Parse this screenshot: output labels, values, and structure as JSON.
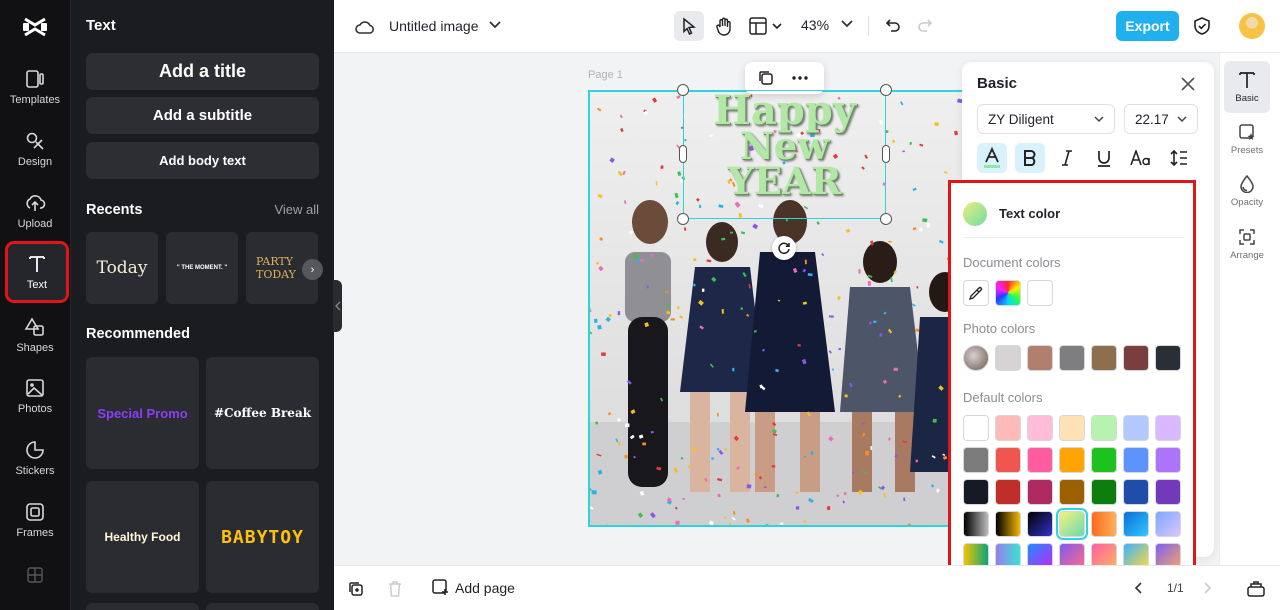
{
  "rail": {
    "items": [
      {
        "label": "Templates",
        "icon": "templates-icon"
      },
      {
        "label": "Design",
        "icon": "design-icon"
      },
      {
        "label": "Upload",
        "icon": "upload-icon"
      },
      {
        "label": "Text",
        "icon": "text-icon",
        "active": true
      },
      {
        "label": "Shapes",
        "icon": "shapes-icon"
      },
      {
        "label": "Photos",
        "icon": "photos-icon"
      },
      {
        "label": "Stickers",
        "icon": "stickers-icon"
      },
      {
        "label": "Frames",
        "icon": "frames-icon"
      }
    ]
  },
  "panel": {
    "title": "Text",
    "add_title": "Add a title",
    "add_subtitle": "Add a subtitle",
    "add_body": "Add body text",
    "recents_title": "Recents",
    "view_all": "View all",
    "recents": [
      "Today",
      "\" THE MOMENT. \"",
      "PARTY TODAY"
    ],
    "recommended_title": "Recommended",
    "recommended": [
      "Special Promo",
      "#Coffee Break",
      "Healthy Food",
      "BABYTOY"
    ]
  },
  "topbar": {
    "doc_title": "Untitled image",
    "zoom": "43%",
    "export_label": "Export"
  },
  "canvas": {
    "page_label": "Page 1",
    "text_lines": [
      "Happy",
      "New",
      "YEAR"
    ],
    "text_color": "#b2e7a5"
  },
  "basic": {
    "title": "Basic",
    "font_name": "ZY Diligent",
    "font_size": "22.17",
    "text_color_label": "Text color",
    "document_colors_label": "Document colors",
    "photo_colors_label": "Photo colors",
    "default_colors_label": "Default colors",
    "photo_colors": [
      "#d7d2d3",
      "#b07f6f",
      "#7e7e80",
      "#8d6e4f",
      "#7a3f3c",
      "#2a2e36"
    ],
    "default_colors": [
      [
        "#ffffff",
        "#ffb9b6",
        "#ffbdd8",
        "#ffe2b3",
        "#b6f2b0",
        "#b2c8ff",
        "#d8b9ff"
      ],
      [
        "#7b7b7b",
        "#f0564f",
        "#ff5ca2",
        "#ffa400",
        "#1ec21e",
        "#5d94f9",
        "#ac75f9"
      ],
      [
        "#161a24",
        "#c02e2a",
        "#b02a62",
        "#9b6000",
        "#0c7c0c",
        "#1f4ea8",
        "#7339bd"
      ]
    ]
  },
  "right_rail": {
    "items": [
      {
        "label": "Basic",
        "icon": "text-basic-icon",
        "active": true
      },
      {
        "label": "Presets",
        "icon": "presets-icon"
      },
      {
        "label": "Opacity",
        "icon": "opacity-icon"
      },
      {
        "label": "Arrange",
        "icon": "arrange-icon"
      }
    ]
  },
  "bottombar": {
    "add_page": "Add page",
    "pager": "1/1"
  }
}
